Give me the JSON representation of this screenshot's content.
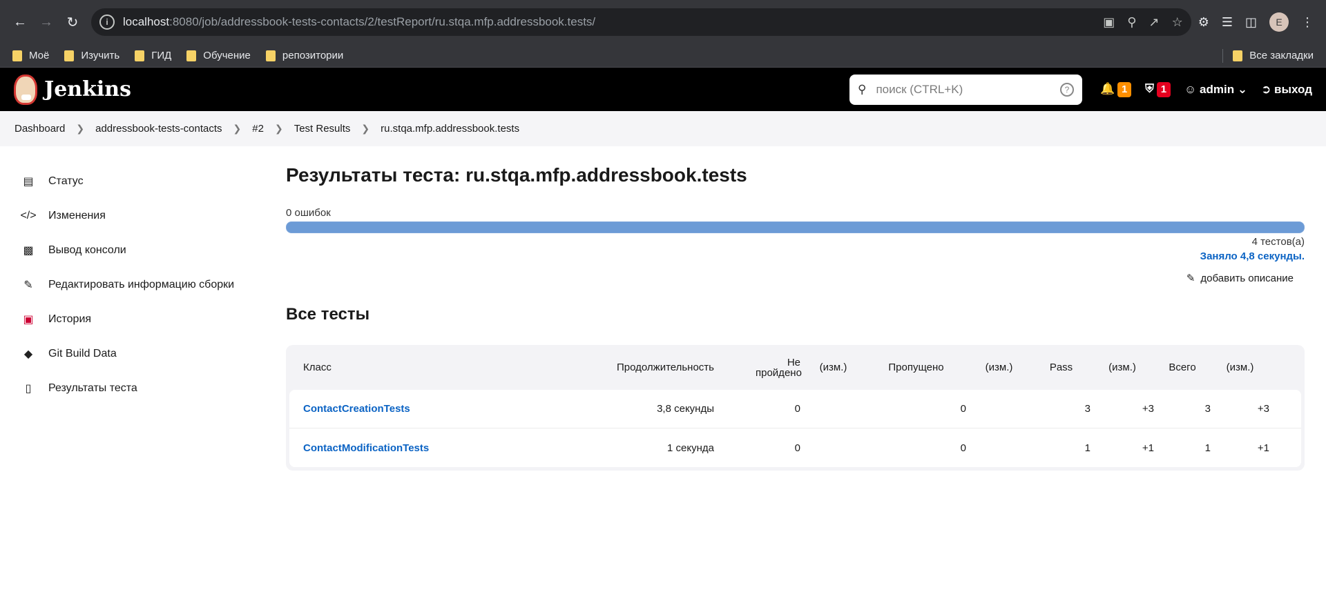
{
  "browser": {
    "url_host": "localhost",
    "url_path": ":8080/job/addressbook-tests-contacts/2/testReport/ru.stqa.mfp.addressbook.tests/",
    "profile_initial": "E"
  },
  "bookmarks": {
    "items": [
      {
        "label": "Моё"
      },
      {
        "label": "Изучить"
      },
      {
        "label": "ГИД"
      },
      {
        "label": "Обучение"
      },
      {
        "label": "репозитории"
      }
    ],
    "all_bookmarks": "Все закладки"
  },
  "header": {
    "brand": "Jenkins",
    "search_placeholder": "поиск (CTRL+K)",
    "notifications_count": "1",
    "security_count": "1",
    "user": "admin",
    "logout": "выход"
  },
  "breadcrumb": [
    {
      "label": "Dashboard"
    },
    {
      "label": "addressbook-tests-contacts"
    },
    {
      "label": "#2"
    },
    {
      "label": "Test Results"
    },
    {
      "label": "ru.stqa.mfp.addressbook.tests"
    }
  ],
  "sidebar": {
    "items": [
      {
        "label": "Статус",
        "icon": "document-icon"
      },
      {
        "label": "Изменения",
        "icon": "code-icon"
      },
      {
        "label": "Вывод консоли",
        "icon": "terminal-icon"
      },
      {
        "label": "Редактировать информацию сборки",
        "icon": "edit-icon"
      },
      {
        "label": "История",
        "icon": "history-icon"
      },
      {
        "label": "Git Build Data",
        "icon": "git-icon"
      },
      {
        "label": "Результаты теста",
        "icon": "clipboard-icon"
      }
    ]
  },
  "main": {
    "title": "Результаты теста: ru.stqa.mfp.addressbook.tests",
    "failures": "0 ошибок",
    "pass_fraction": 1.0,
    "tests_count": "4 тестов(а)",
    "took": "Заняло 4,8 секунды.",
    "add_description": "добавить описание",
    "all_tests_heading": "Все тесты",
    "table": {
      "headers": [
        "Класс",
        "Продолжительность",
        "Не пройдено",
        "(изм.)",
        "Пропущено",
        "(изм.)",
        "Pass",
        "(изм.)",
        "Всего",
        "(изм.)"
      ],
      "rows": [
        {
          "cls": "ContactCreationTests",
          "duration": "3,8 секунды",
          "failed": "0",
          "failed_diff": "",
          "skipped": "0",
          "skipped_diff": "",
          "pass": "3",
          "pass_diff": "+3",
          "total": "3",
          "total_diff": "+3"
        },
        {
          "cls": "ContactModificationTests",
          "duration": "1 секунда",
          "failed": "0",
          "failed_diff": "",
          "skipped": "0",
          "skipped_diff": "",
          "pass": "1",
          "pass_diff": "+1",
          "total": "1",
          "total_diff": "+1"
        }
      ]
    }
  },
  "colors": {
    "progress_pass": "#6c9bd6",
    "link": "#0b63c4",
    "badge_orange": "#fe8f00",
    "badge_red": "#e6001f"
  }
}
